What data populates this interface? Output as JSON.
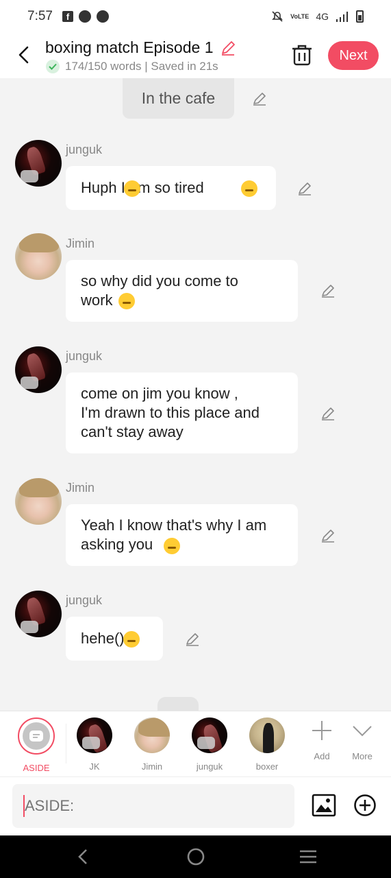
{
  "status_bar": {
    "time": "7:57",
    "network": "4G",
    "volte": "VoLTE"
  },
  "header": {
    "title": "boxing match Episode 1",
    "subtitle": "174/150 words | Saved in 21s",
    "next_label": "Next"
  },
  "chat": {
    "scene_label": "In the cafe",
    "messages": [
      {
        "speaker": "junguk",
        "text": "Huph  I am so tired "
      },
      {
        "speaker": "Jimin",
        "text": "so why did you come to\nwork"
      },
      {
        "speaker": "junguk",
        "text": "come on jim you know ,\nI'm drawn to this place and\ncan't stay away"
      },
      {
        "speaker": "Jimin",
        "text": "Yeah I know that's why I am\nasking you "
      },
      {
        "speaker": "junguk",
        "text": "hehe()"
      }
    ]
  },
  "characters": {
    "aside": "ASIDE",
    "items": [
      "JK",
      "Jimin",
      "junguk",
      "boxer"
    ],
    "add_label": "Add",
    "more_label": "More"
  },
  "input": {
    "placeholder": "ASIDE:"
  },
  "colors": {
    "accent": "#f24c63",
    "background": "#f3f3f3",
    "bubble": "#ffffff"
  }
}
